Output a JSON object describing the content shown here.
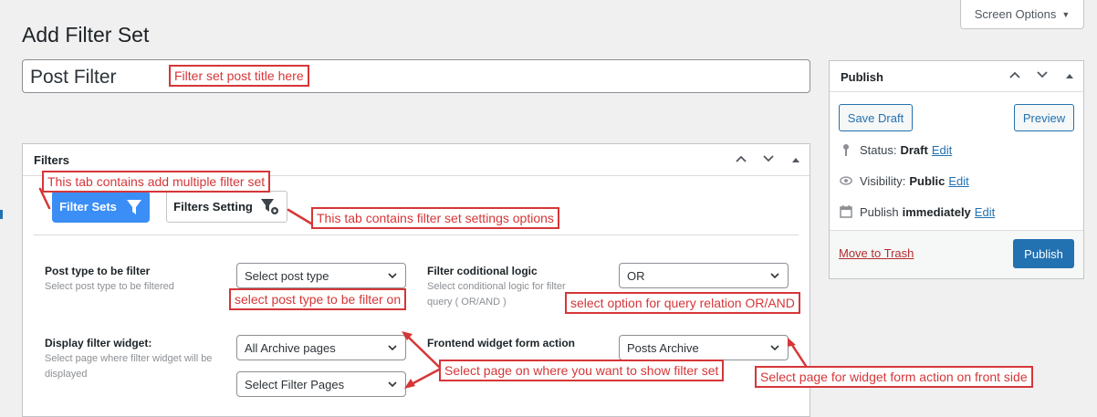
{
  "page": {
    "title": "Add Filter Set",
    "screen_options": "Screen Options"
  },
  "title_field": {
    "value": "Post Filter"
  },
  "publish_box": {
    "title": "Publish",
    "save_draft": "Save Draft",
    "preview": "Preview",
    "status_label": "Status:",
    "status_value": "Draft",
    "visibility_label": "Visibility:",
    "visibility_value": "Public",
    "publish_label": "Publish",
    "publish_value": "immediately",
    "edit": "Edit",
    "move_to_trash": "Move to Trash",
    "publish_button": "Publish"
  },
  "filters_box": {
    "title": "Filters",
    "tabs": [
      {
        "label": "Filter Sets",
        "active": true,
        "icon": "funnel-icon"
      },
      {
        "label": "Filters Setting",
        "active": false,
        "icon": "funnel-gear-icon"
      }
    ],
    "fields": [
      {
        "label": "Post type to be filter",
        "description": "Select post type to be filtered",
        "select": "Select post type"
      },
      {
        "label": "Filter coditional logic",
        "description": "Select conditional logic for filter query ( OR/AND )",
        "select": "OR"
      },
      {
        "label": "Display filter widget:",
        "description": "Select page where filter widget will be displayed",
        "select": "All Archive pages",
        "select2": "Select Filter Pages"
      },
      {
        "label": "Frontend widget form action",
        "description": "",
        "select": "Posts Archive"
      }
    ]
  },
  "annotations": {
    "title": "Filter set post title here",
    "tab_sets": "This tab contains add multiple filter set",
    "tab_settings": "This tab contains filter set settings options",
    "post_type": "select post type to be filter on",
    "query_relation": "select option for query relation OR/AND",
    "show_filter": "Select page on where you want to show filter set",
    "form_action": "Select page for widget form action on front side"
  },
  "colors": {
    "accent": "#2271b1",
    "tab_active": "#3a8ef6",
    "annotation": "#d63638",
    "background": "#f0f0f1"
  }
}
